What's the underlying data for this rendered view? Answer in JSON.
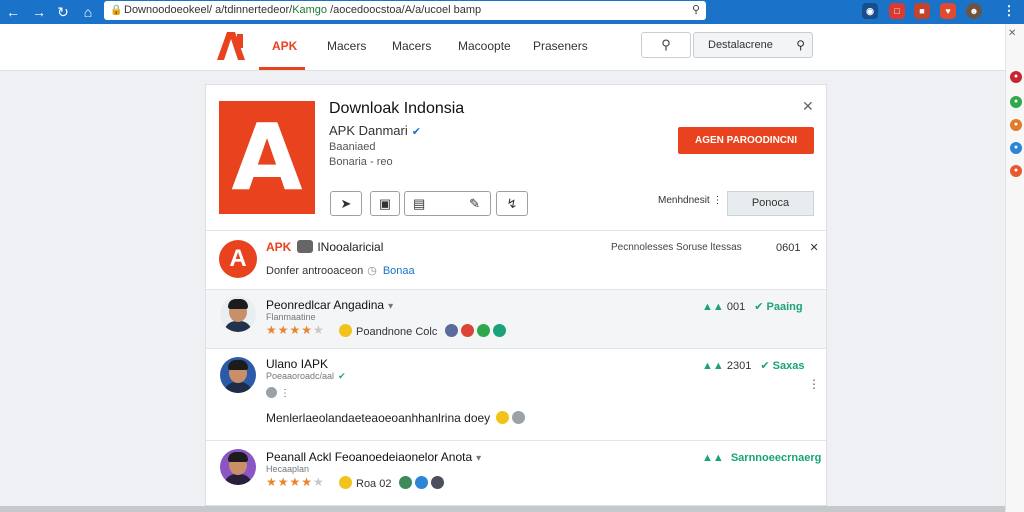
{
  "browser": {
    "url": "Downoodoeokeel/ a/tdinnertedeor/",
    "url_host": "Kamgo",
    "url_rest": " /aocedoocstoa/A/a/ucoel bamp"
  },
  "header": {
    "nav": [
      "APK",
      "Macers",
      "Macers",
      "Macoopte",
      "Praseners"
    ],
    "search_placeholder": "Destalacrene"
  },
  "app": {
    "title": "Downloak Indonsia",
    "subtitle": "APK Danmari",
    "meta1": "Baaniaed",
    "meta2": "Bonaria - reo",
    "install_label": "AGEN PAROODINCNI",
    "more_label": "Menhdnesit",
    "secondary_label": "Ponoca"
  },
  "developer": {
    "brand": "APK",
    "name": "INooalaricial",
    "desc": "Donfer antrooaceon",
    "link": "Bonaa",
    "stats": "Pecnnolesses Soruse ltessas",
    "count": "0601"
  },
  "reviews": [
    {
      "name": "Peonredlcar Angadina",
      "sub": "Flanmaatine",
      "rating": 4,
      "badge": "Poandnone Colc",
      "votes": "001",
      "vote_label": "Paaing"
    },
    {
      "name": "Ulano IAPK",
      "sub": "Poeaaoroadc/aal",
      "votes": "2301",
      "vote_label": "Saxas",
      "body": "Menlerlaeolandaeteaoeoanhhanlrina doey"
    },
    {
      "name": "Peanall Ackl Feoanoedeiaonelor Anota",
      "sub": "Hecaaplan",
      "rating": 4,
      "badge": "Roa  02",
      "vote_label": "Sarnnoeecrnaerg"
    }
  ],
  "colors": {
    "accent": "#e8421e",
    "browser_bar": "#1a73c9",
    "teal": "#1aa37a",
    "link": "#1a73c9"
  }
}
